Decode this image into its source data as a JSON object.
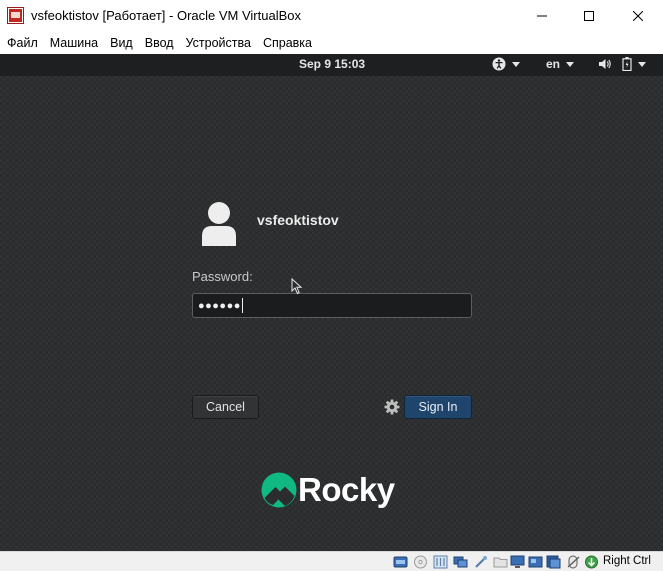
{
  "window": {
    "title": "vsfeoktistov [Работает] - Oracle VM VirtualBox",
    "minimize_glyph": "—",
    "maximize_glyph": "☐",
    "close_glyph": "✕"
  },
  "menubar": {
    "items": [
      "Файл",
      "Машина",
      "Вид",
      "Ввод",
      "Устройства",
      "Справка"
    ]
  },
  "gnome_bar": {
    "clock": "Sep 9  15:03",
    "language": "en"
  },
  "login": {
    "username": "vsfeoktistov",
    "password_label": "Password:",
    "password_masked": "●●●●●●",
    "cancel_label": "Cancel",
    "signin_label": "Sign In"
  },
  "branding": {
    "logo_text": "Rocky",
    "accent_color": "#10b981"
  },
  "statusbar": {
    "icons": [
      "hard-disk-icon",
      "optical-drive-icon",
      "audio-icon",
      "network-icon",
      "usb-icon",
      "shared-folders-icon",
      "display-icon",
      "capture-icon",
      "recording-icon",
      "mouse-integration-icon",
      "keyboard-capture-icon"
    ],
    "host_key": "Right Ctrl"
  }
}
